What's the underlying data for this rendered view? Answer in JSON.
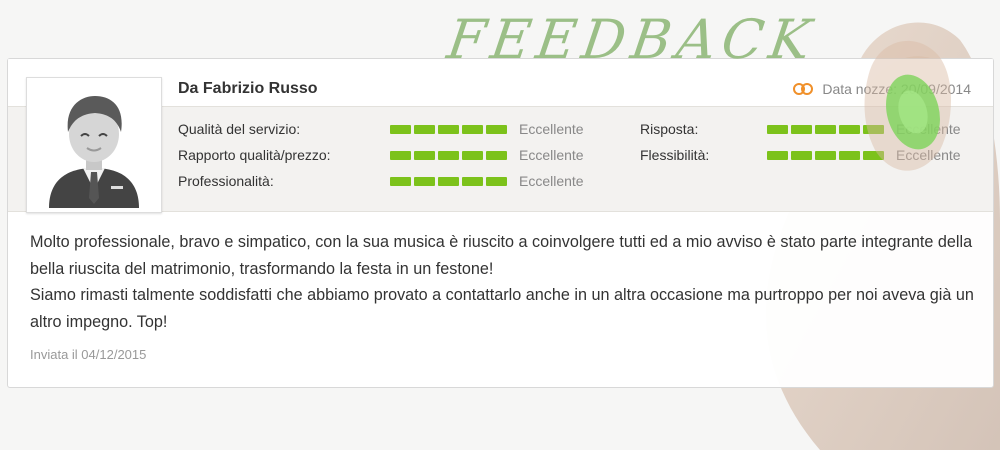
{
  "banner": {
    "title": "FEEDBACK"
  },
  "review": {
    "author": "Da Fabrizio Russo",
    "wedding_date_label": "Data nozze: 20/09/2014",
    "ratings_left": [
      {
        "label": "Qualità del servizio:",
        "value": "Eccellente",
        "score": 5
      },
      {
        "label": "Rapporto qualità/prezzo:",
        "value": "Eccellente",
        "score": 5
      },
      {
        "label": "Professionalità:",
        "value": "Eccellente",
        "score": 5
      }
    ],
    "ratings_right": [
      {
        "label": "Risposta:",
        "value": "Eccellente",
        "score": 5
      },
      {
        "label": "Flessibilità:",
        "value": "Eccellente",
        "score": 5
      }
    ],
    "body": [
      "Molto professionale, bravo e simpatico, con la sua musica è riuscito a coinvolgere tutti ed a mio avviso è stato parte integrante della bella riuscita del matrimonio, trasformando la festa in un festone!",
      "Siamo rimasti talmente soddisfatti che abbiamo provato a contattarlo anche in un altra occasione ma purtroppo per noi aveva già un altro impegno. Top!"
    ],
    "sent_date": "Inviata il 04/12/2015"
  },
  "icons": {
    "avatar": "user-avatar-icon",
    "rings": "wedding-rings-icon",
    "hand": "hand-pressing-button-icon"
  },
  "colors": {
    "rating_bar": "#7cc21b",
    "title": "#9bbf87",
    "rings": "#f0902a",
    "button": "#7dd35a"
  }
}
